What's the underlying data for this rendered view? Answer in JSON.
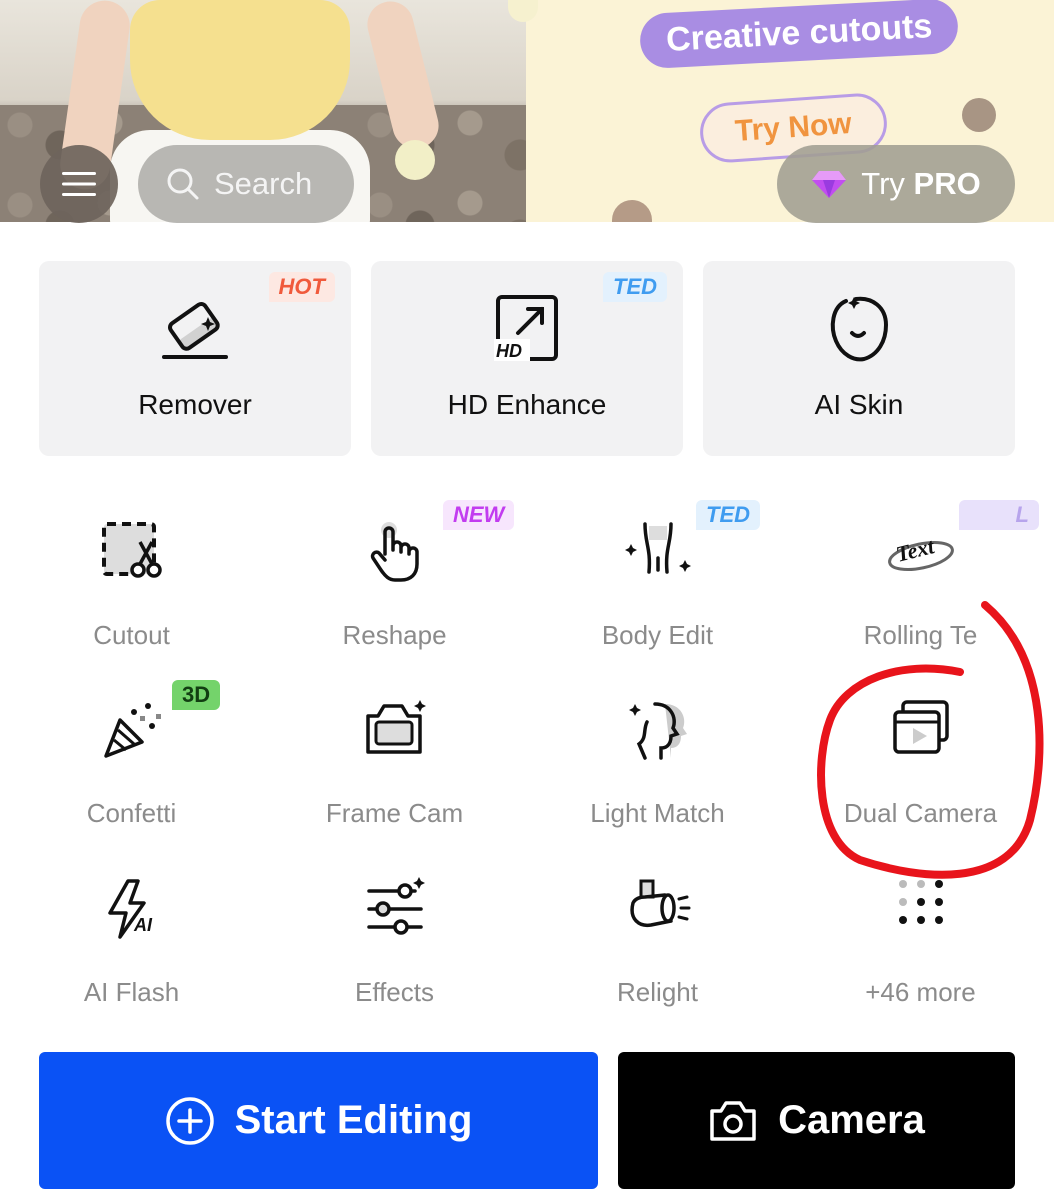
{
  "header": {
    "search_placeholder": "Search",
    "promo_title": "Creative cutouts",
    "promo_cta": "Try Now",
    "pro_label_prefix": "Try",
    "pro_label_bold": "PRO"
  },
  "cards": [
    {
      "label": "Remover",
      "tag": "HOT",
      "icon": "eraser-icon"
    },
    {
      "label": "HD Enhance",
      "tag": "TED",
      "icon": "hd-enhance-icon"
    },
    {
      "label": "AI Skin",
      "tag": "",
      "icon": "face-outline-icon"
    }
  ],
  "grid": [
    {
      "label": "Cutout",
      "tag": "",
      "icon": "cutout-scissors-icon"
    },
    {
      "label": "Reshape",
      "tag": "NEW",
      "icon": "hand-pointer-icon"
    },
    {
      "label": "Body Edit",
      "tag": "TED",
      "icon": "body-edit-icon"
    },
    {
      "label": "Rolling Te",
      "tag": "L",
      "icon": "rolling-text-icon"
    },
    {
      "label": "Confetti",
      "tag": "3D",
      "icon": "party-popper-icon"
    },
    {
      "label": "Frame Cam",
      "tag": "",
      "icon": "frame-camera-icon"
    },
    {
      "label": "Light Match",
      "tag": "",
      "icon": "light-match-icon"
    },
    {
      "label": "Dual Camera",
      "tag": "",
      "icon": "dual-camera-icon"
    },
    {
      "label": "AI Flash",
      "tag": "",
      "icon": "ai-flash-icon"
    },
    {
      "label": "Effects",
      "tag": "",
      "icon": "sliders-icon"
    },
    {
      "label": "Relight",
      "tag": "",
      "icon": "spotlight-icon"
    },
    {
      "label": "+46 more",
      "tag": "",
      "icon": "dots-grid-icon"
    }
  ],
  "buttons": {
    "start_label": "Start Editing",
    "camera_label": "Camera"
  },
  "colors": {
    "primary": "#0a52f5",
    "annotation": "#e8141b",
    "hot_tag": "#f05a3c",
    "new_tag": "#c23cf0",
    "ted_tag": "#3f9cf0"
  }
}
